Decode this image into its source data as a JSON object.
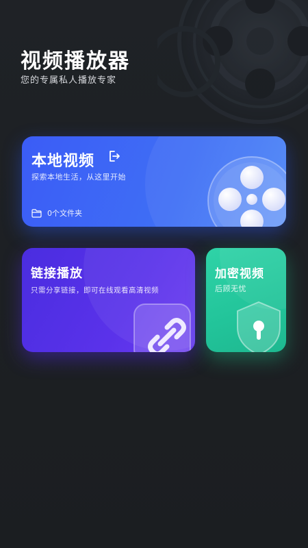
{
  "header": {
    "title": "视频播放器",
    "subtitle": "您的专属私人播放专家"
  },
  "cards": {
    "local": {
      "title": "本地视频",
      "description": "探索本地生活，从这里开始",
      "folder_count_label": "0个文件夹",
      "icons": [
        "enter-icon",
        "folder-icon",
        "film-reel-icon"
      ]
    },
    "link": {
      "title": "链接播放",
      "description": "只需分享链接，即可在线观看高清视频",
      "icons": [
        "chain-link-icon"
      ]
    },
    "secure": {
      "title": "加密视频",
      "description": "后顾无忧",
      "icons": [
        "shield-lock-icon"
      ]
    }
  },
  "colors": {
    "background": "#1d2023",
    "local_card": "#3f6ff5",
    "link_card": "#5a32ea",
    "secure_card": "#22c49a"
  }
}
